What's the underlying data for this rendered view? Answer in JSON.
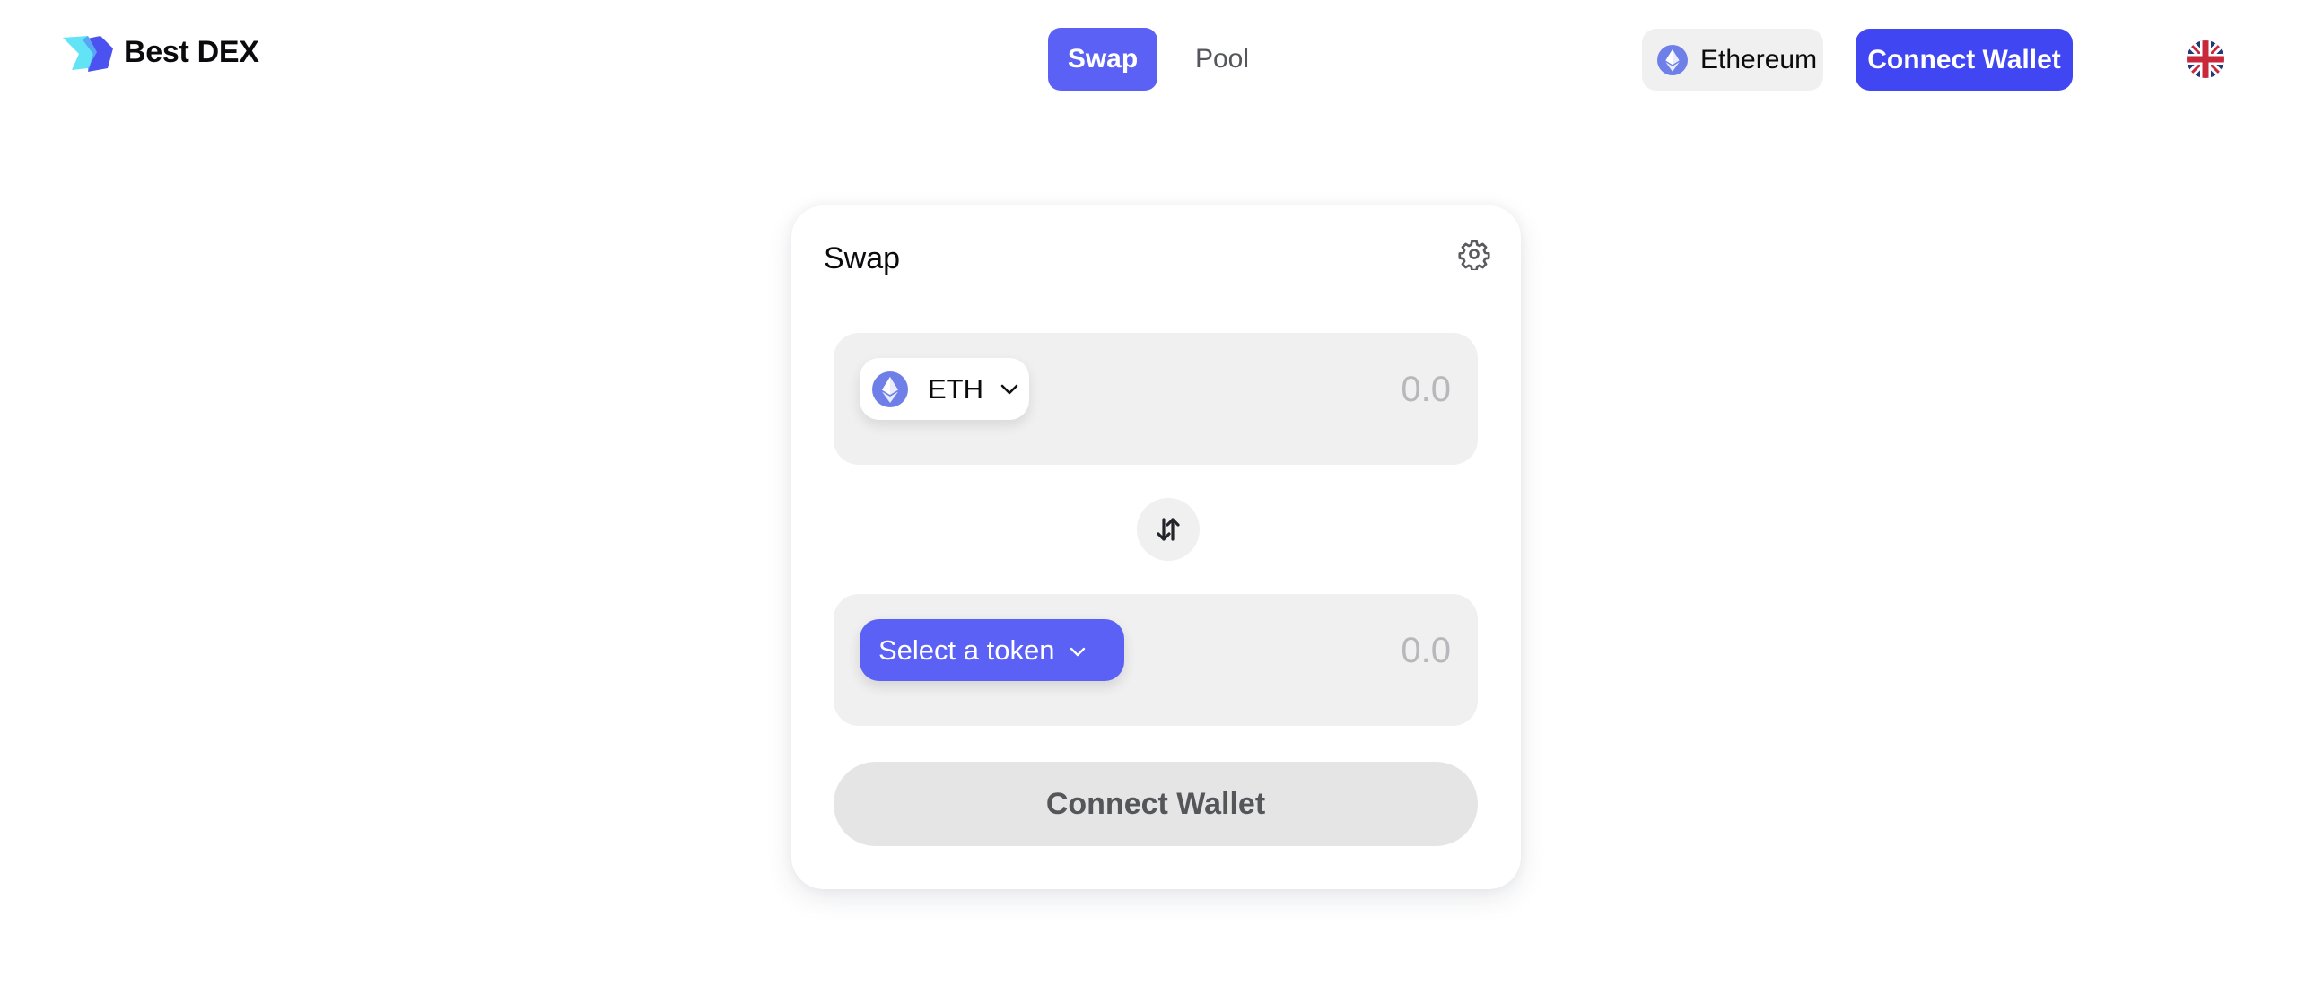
{
  "header": {
    "brand": "Best DEX",
    "nav": [
      {
        "label": "Swap",
        "active": true
      },
      {
        "label": "Pool",
        "active": false
      }
    ],
    "network": {
      "label": "Ethereum",
      "icon": "ethereum-icon"
    },
    "connect_wallet_label": "Connect Wallet",
    "language": {
      "icon": "uk-flag-icon"
    }
  },
  "swap_card": {
    "title": "Swap",
    "settings_icon": "gear-icon",
    "from": {
      "token_symbol": "ETH",
      "token_icon": "ethereum-icon",
      "amount_placeholder": "0.0"
    },
    "switch_icon": "swap-vertical-arrows-icon",
    "to": {
      "select_label": "Select a token",
      "amount_placeholder": "0.0"
    },
    "connect_wallet_label": "Connect Wallet"
  },
  "colors": {
    "accent": "#5b61f5",
    "connect_primary": "#4046f2",
    "input_bg": "#f0f0f0",
    "disabled_button_bg": "#e5e5e5",
    "disabled_button_text": "#55565a",
    "placeholder_text": "#b8b8bc"
  }
}
